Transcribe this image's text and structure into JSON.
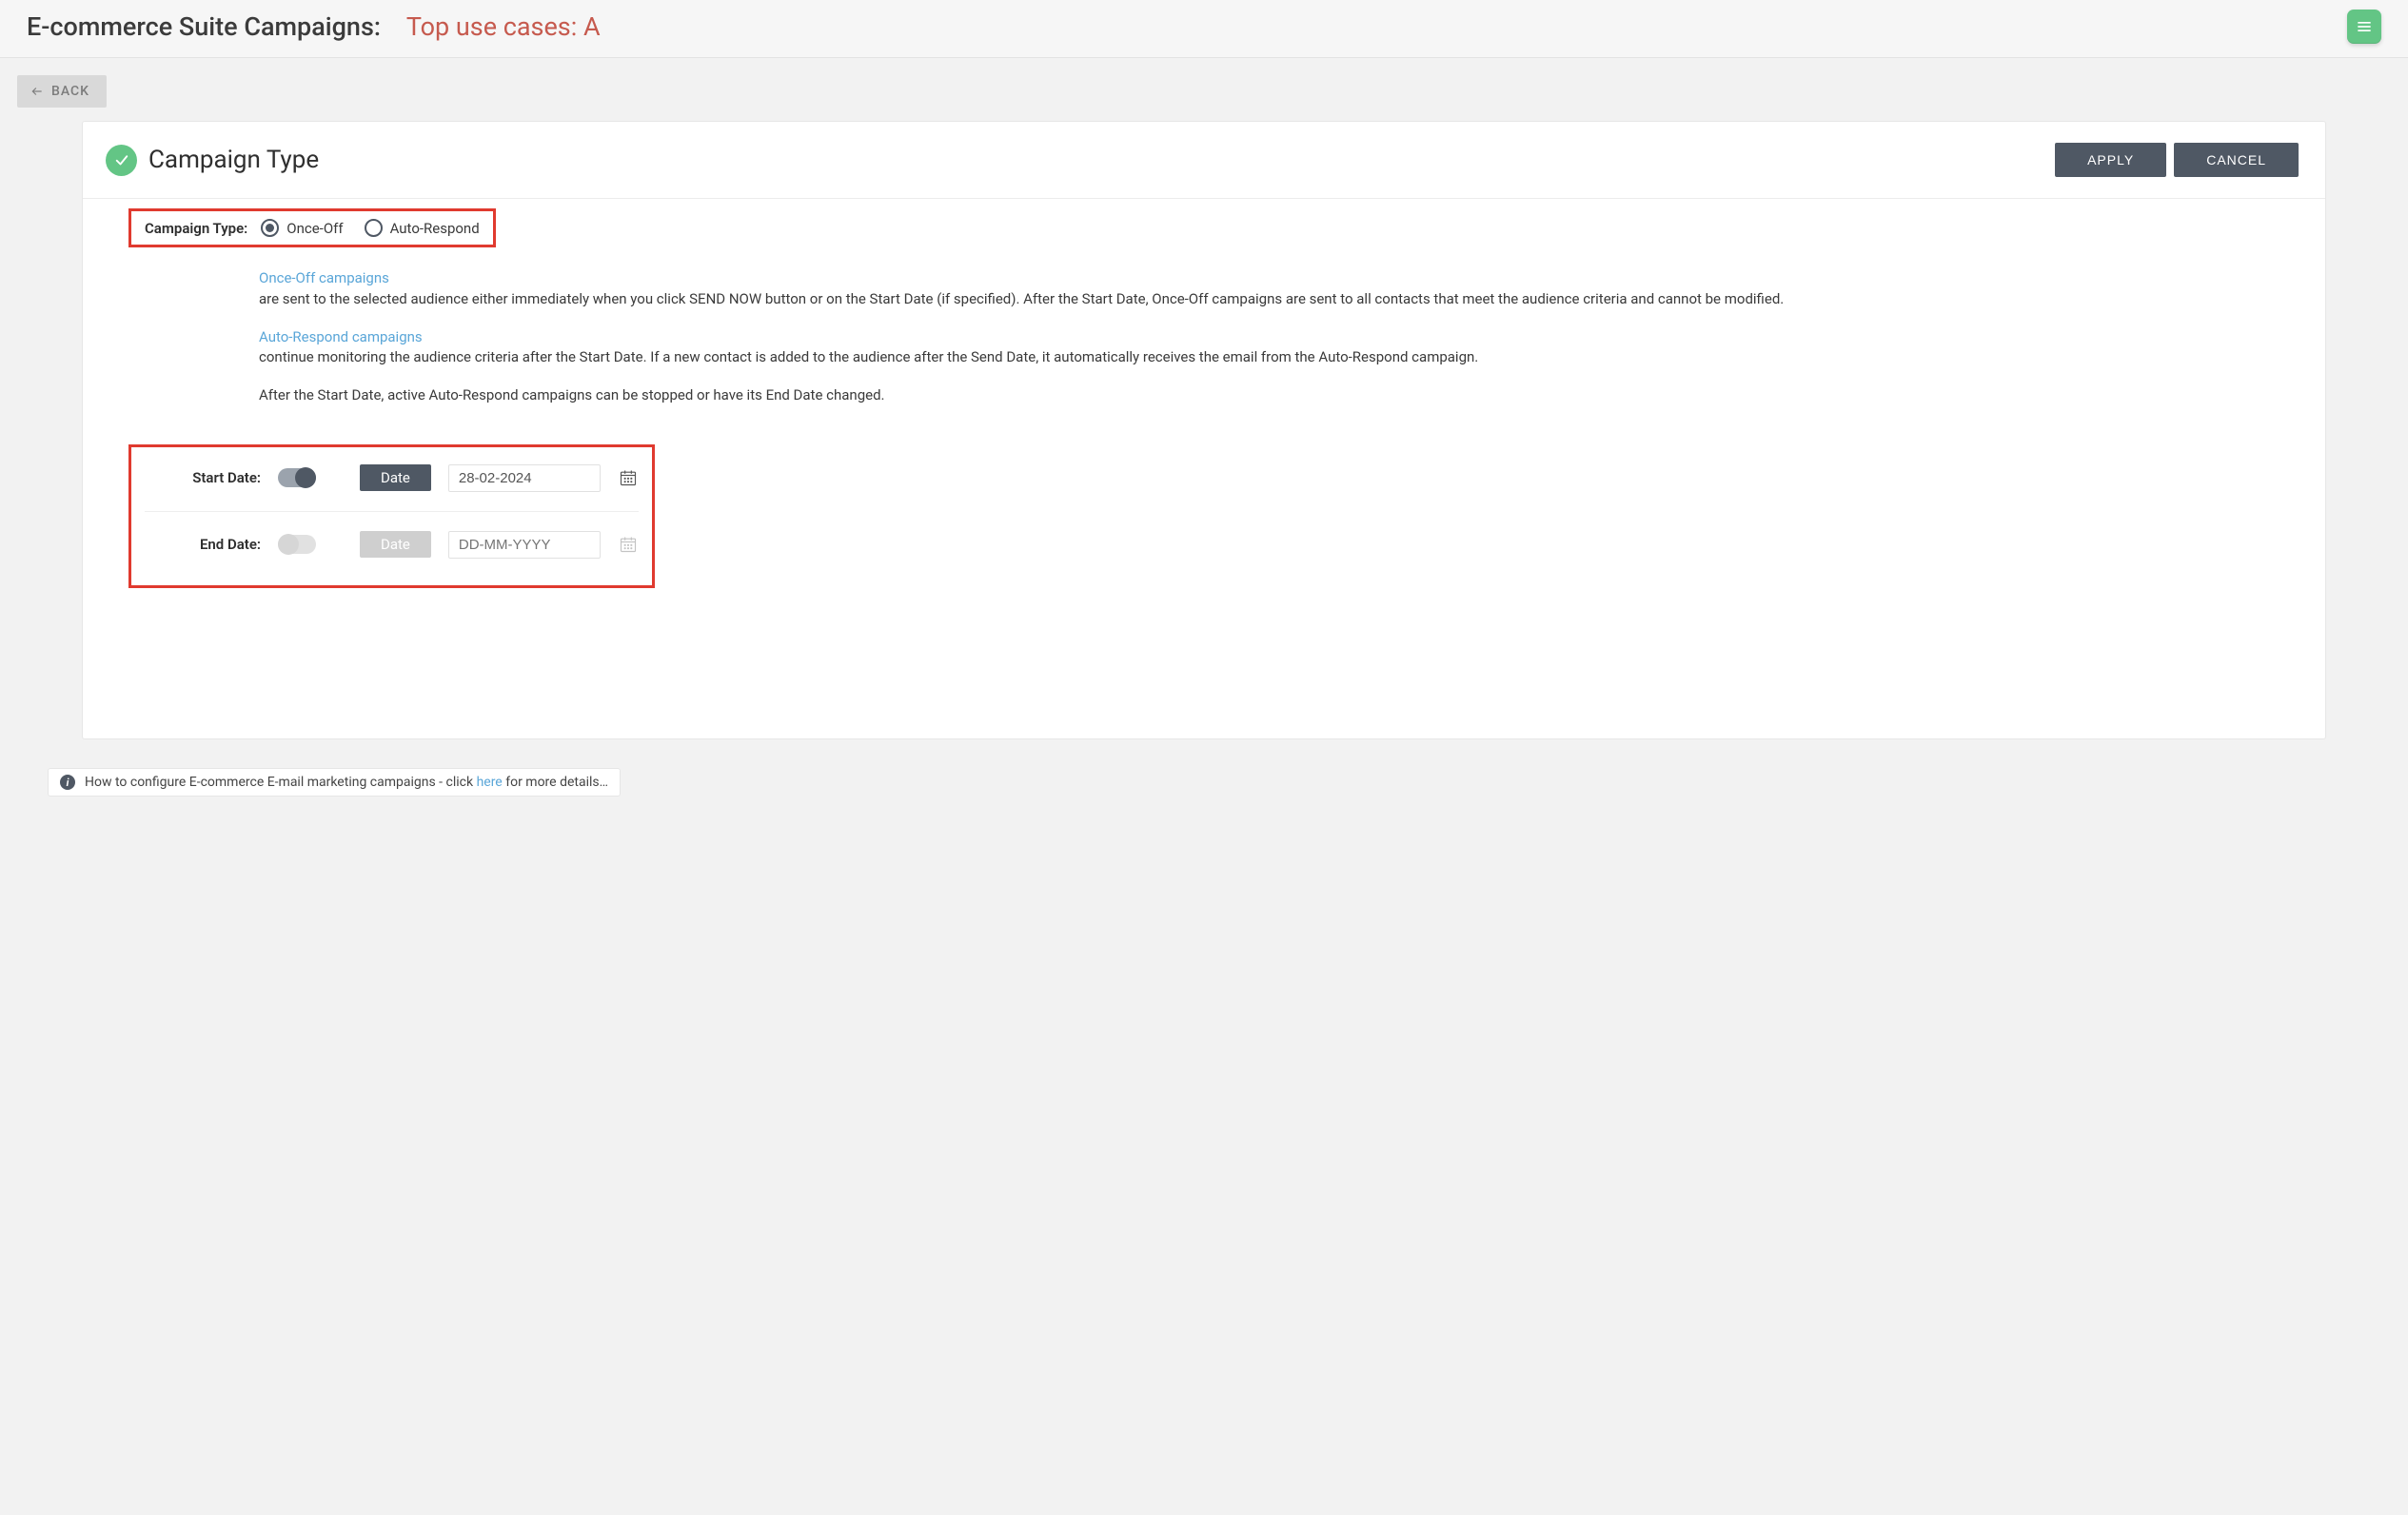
{
  "topbar": {
    "title_prefix": "E-commerce Suite Campaigns:",
    "title_sub": "Top use cases: A"
  },
  "back_label": "BACK",
  "section": {
    "title": "Campaign Type",
    "apply_label": "APPLY",
    "cancel_label": "CANCEL"
  },
  "campaign_type": {
    "label": "Campaign Type:",
    "options": {
      "once_off": "Once-Off",
      "auto_respond": "Auto-Respond"
    },
    "selected": "once_off"
  },
  "descriptions": {
    "once_off_title": "Once-Off campaigns",
    "once_off_body": "are sent to the selected audience either immediately when you click SEND NOW button or on the Start Date (if specified). After the Start Date, Once-Off campaigns are sent to all contacts that meet the audience criteria and cannot be modified.",
    "auto_title": "Auto-Respond campaigns",
    "auto_body": "continue monitoring the audience criteria after the Start Date. If a new contact is added to the audience after the Send Date, it automatically receives the email from the Auto-Respond campaign.",
    "after_note": "After the Start Date, active Auto-Respond campaigns can be stopped or have its End Date changed."
  },
  "dates": {
    "start": {
      "label": "Start Date:",
      "enabled": true,
      "btn": "Date",
      "value": "28-02-2024"
    },
    "end": {
      "label": "End Date:",
      "enabled": false,
      "btn": "Date",
      "placeholder": "DD-MM-YYYY"
    }
  },
  "footer": {
    "text_a": "How to configure E-commerce E-mail marketing campaigns - click ",
    "link": "here",
    "text_b": " for more details…"
  }
}
